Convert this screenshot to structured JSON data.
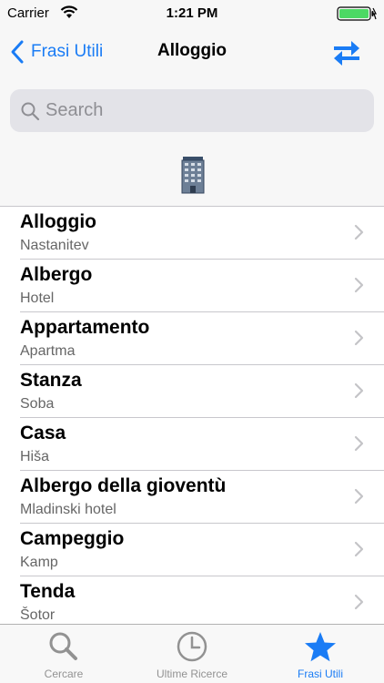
{
  "status": {
    "carrier": "Carrier",
    "time": "1:21 PM"
  },
  "nav": {
    "back_label": "Frasi Utili",
    "title": "Alloggio",
    "action_icon": "swap-arrows-icon"
  },
  "search": {
    "placeholder": "Search",
    "value": ""
  },
  "section": {
    "icon": "hotel-building-icon"
  },
  "items": [
    {
      "title": "Alloggio",
      "subtitle": "Nastanitev"
    },
    {
      "title": "Albergo",
      "subtitle": "Hotel"
    },
    {
      "title": "Appartamento",
      "subtitle": "Apartma"
    },
    {
      "title": "Stanza",
      "subtitle": "Soba"
    },
    {
      "title": "Casa",
      "subtitle": "Hiša"
    },
    {
      "title": "Albergo della gioventù",
      "subtitle": "Mladinski hotel"
    },
    {
      "title": "Campeggio",
      "subtitle": "Kamp"
    },
    {
      "title": "Tenda",
      "subtitle": "Šotor"
    }
  ],
  "tabs": [
    {
      "label": "Cercare",
      "icon": "search-icon",
      "active": false
    },
    {
      "label": "Ultime Ricerce",
      "icon": "clock-icon",
      "active": false
    },
    {
      "label": "Frasi Utili",
      "icon": "star-icon",
      "active": true
    }
  ],
  "colors": {
    "accent": "#1a7cf5",
    "inactive": "#929292",
    "background": "#f7f7f7"
  }
}
